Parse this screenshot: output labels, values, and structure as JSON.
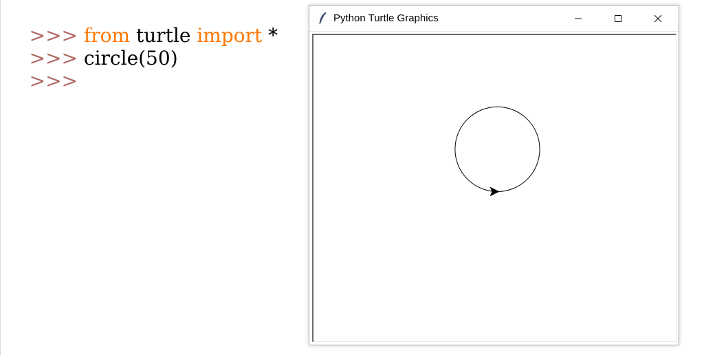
{
  "shell": {
    "prompt": ">>>",
    "lines": [
      {
        "prompt": ">>>",
        "kw1": "from",
        "mid": " turtle ",
        "kw2": "import",
        "tail": " *"
      },
      {
        "prompt": ">>>",
        "code": "circle(50)"
      },
      {
        "prompt": ">>>"
      }
    ]
  },
  "turtle_window": {
    "title": "Python Turtle Graphics",
    "title_icon": "feather-icon",
    "buttons": {
      "minimize": "minimize-icon",
      "maximize": "maximize-icon",
      "close": "close-icon"
    },
    "drawing": {
      "shape": "circle",
      "radius": 50,
      "pen_color": "#000000",
      "turtle_shape": "arrow"
    }
  },
  "colors": {
    "prompt": "#b06a66",
    "keyword": "#ff7700",
    "code": "#000000"
  }
}
